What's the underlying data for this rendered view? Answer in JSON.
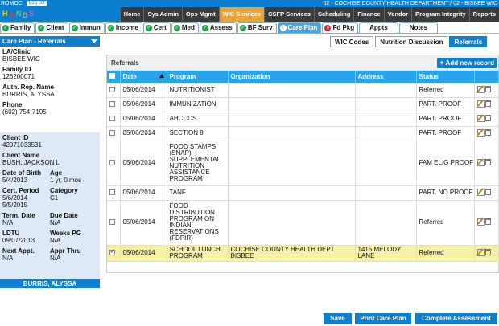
{
  "topbar": {
    "user": "ROMOC",
    "logout": "Log Off",
    "org": "02 - COCHISE COUNTY HEALTH DEPARTMENT / 02 - BISBEE WIC"
  },
  "logo": {
    "text": "HANDS"
  },
  "main_nav": [
    "Home",
    "Sys Admin",
    "Ops Mgmt",
    "WIC Services",
    "CSFP Services",
    "Scheduling",
    "Finance",
    "Vendor",
    "Program Integrity",
    "Reports"
  ],
  "main_nav_active": "WIC Services",
  "sub_tabs": [
    {
      "label": "Family",
      "status": "check"
    },
    {
      "label": "Client",
      "status": "check"
    },
    {
      "label": "Immun",
      "status": "check"
    },
    {
      "label": "Income",
      "status": "check"
    },
    {
      "label": "Cert",
      "status": "check"
    },
    {
      "label": "Med",
      "status": "check"
    },
    {
      "label": "Assess",
      "status": "check"
    },
    {
      "label": "BF Surv",
      "status": "check"
    },
    {
      "label": "Care Plan",
      "status": "check",
      "active": true
    },
    {
      "label": "Fd Pkg",
      "status": "x"
    },
    {
      "label": "Appts",
      "status": "none"
    },
    {
      "label": "Notes",
      "status": "none"
    }
  ],
  "left_panel": {
    "title": "Care Plan - Referrals",
    "la_clinic_label": "LA/Clinic",
    "la_clinic": "BISBEE WIC",
    "family_id_label": "Family ID",
    "family_id": "126200071",
    "auth_rep_label": "Auth. Rep. Name",
    "auth_rep": "BURRIS, ALYSSA",
    "phone_label": "Phone",
    "phone": "(602) 754-7195",
    "client_id_label": "Client ID",
    "client_id": "42071033531",
    "client_name_label": "Client Name",
    "client_name": "BUSH, JACKSON L",
    "dob_label": "Date of Birth",
    "dob": "5/4/2013",
    "age_label": "Age",
    "age": "1 yr, 0 mos",
    "cert_period_label": "Cert. Period",
    "cert_period": "5/6/2014 -\n5/5/2015",
    "category_label": "Category",
    "category": "C1",
    "term_date_label": "Term. Date",
    "term_date": "N/A",
    "due_date_label": "Due Date",
    "due_date": "N/A",
    "ldtu_label": "LDTU",
    "ldtu": "09/07/2013",
    "weeks_pg_label": "Weeks PG",
    "weeks_pg": "N/A",
    "next_appt_label": "Next Appt.",
    "next_appt": "N/A",
    "appr_thru_label": "Appr Thru",
    "appr_thru": "N/A",
    "footer_name": "BURRIS, ALYSSA"
  },
  "right_tabs": [
    {
      "label": "WIC Codes"
    },
    {
      "label": "Nutrition Discussion"
    },
    {
      "label": "Referrals",
      "active": true
    }
  ],
  "referrals": {
    "title": "Referrals",
    "add_button": "Add new record",
    "columns": [
      "Date",
      "Program",
      "Organization",
      "Address",
      "Status"
    ],
    "rows": [
      {
        "date": "05/06/2014",
        "program": "NUTRITIONIST",
        "organization": "",
        "address": "",
        "status": "Referred",
        "checked": false
      },
      {
        "date": "05/06/2014",
        "program": "IMMUNIZATION",
        "organization": "",
        "address": "",
        "status": "PART. PROOF",
        "checked": false
      },
      {
        "date": "05/06/2014",
        "program": "AHCCCS",
        "organization": "",
        "address": "",
        "status": "PART. PROOF",
        "checked": false
      },
      {
        "date": "05/06/2014",
        "program": "SECTION 8",
        "organization": "",
        "address": "",
        "status": "PART. PROOF",
        "checked": false
      },
      {
        "date": "05/06/2014",
        "program": "FOOD STAMPS (SNAP) SUPPLEMENTAL NUTRITION ASSISTANCE PROGRAM",
        "organization": "",
        "address": "",
        "status": "FAM ELIG PROOF",
        "checked": false
      },
      {
        "date": "05/06/2014",
        "program": "TANF",
        "organization": "",
        "address": "",
        "status": "PART. NO PROOF",
        "checked": false
      },
      {
        "date": "05/06/2014",
        "program": "FOOD DISTRIBUTION PROGRAM ON INDIAN RESERVATIONS (FDPIR)",
        "organization": "",
        "address": "",
        "status": "Referred",
        "checked": false
      },
      {
        "date": "05/06/2014",
        "program": "SCHOOL LUNCH PROGRAM",
        "organization": "COCHISE COUNTY HEALTH DEPT. BISBEE",
        "address": "1415 MELODY LANE",
        "status": "Referred",
        "checked": true
      }
    ]
  },
  "bottom_buttons": {
    "save": "Save",
    "print": "Print Care Plan",
    "complete": "Complete Assessment"
  },
  "colors": {
    "brand_blue": "#0e7fcf",
    "header_blue": "#28a4ea",
    "active_nav": "#e8a33a",
    "selected_row": "#f6f0a8",
    "check_green": "#22a64a"
  }
}
